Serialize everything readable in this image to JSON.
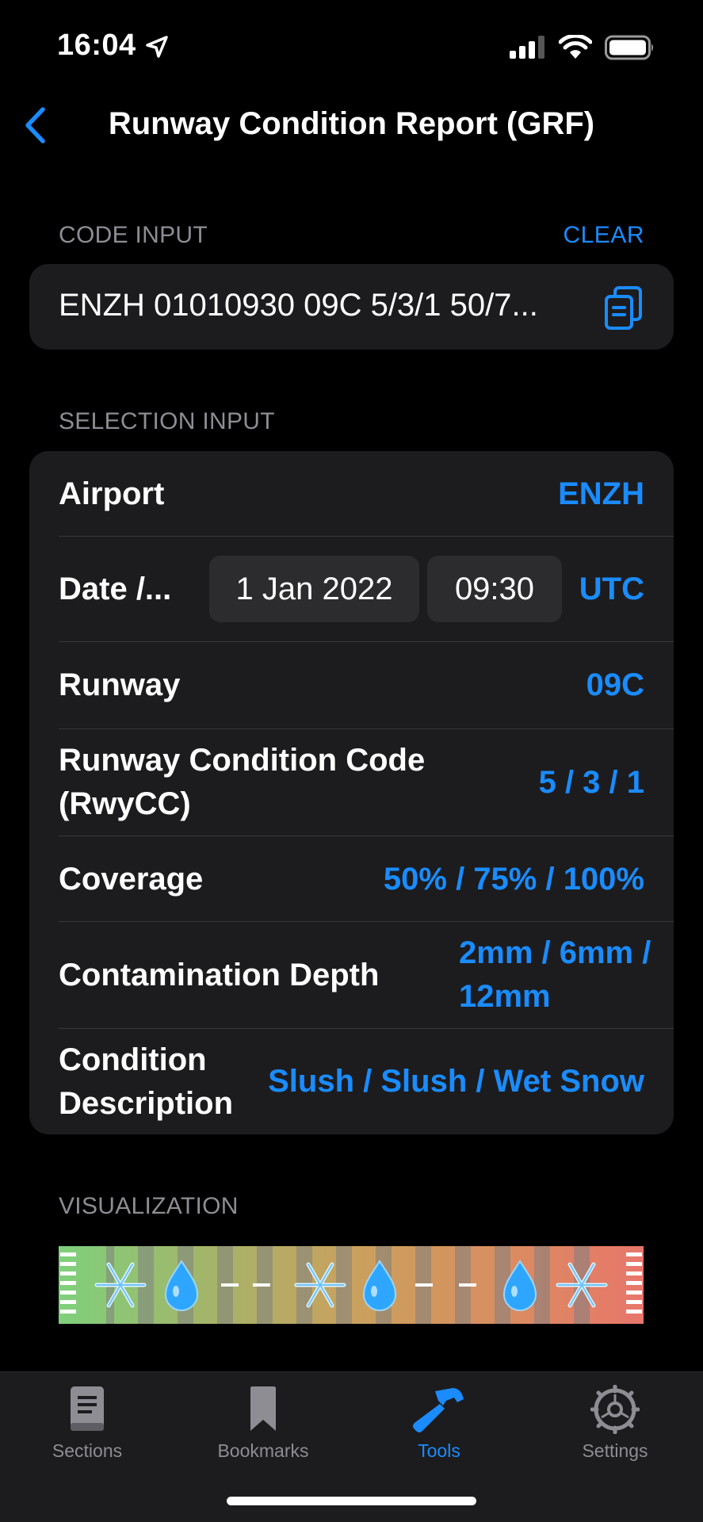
{
  "status": {
    "time": "16:04"
  },
  "nav": {
    "title": "Runway Condition Report (GRF)"
  },
  "code_input": {
    "header": "CODE INPUT",
    "clear_label": "CLEAR",
    "value": "ENZH 01010930 09C 5/3/1 50/7..."
  },
  "selection": {
    "header": "SELECTION INPUT",
    "rows": {
      "airport": {
        "label": "Airport",
        "value": "ENZH"
      },
      "datetime": {
        "label": "Date /...",
        "date": "1 Jan 2022",
        "time": "09:30",
        "zone": "UTC"
      },
      "runway": {
        "label": "Runway",
        "value": "09C"
      },
      "rwycc": {
        "label_line1": "Runway Condition Code",
        "label_line2": "(RwyCC)",
        "value": "5 / 3 / 1"
      },
      "coverage": {
        "label": "Coverage",
        "value": "50% / 75% / 100%"
      },
      "depth": {
        "label": "Contamination Depth",
        "value_line1": "2mm / 6mm /",
        "value_line2": "12mm"
      },
      "condition": {
        "label_line1": "Condition",
        "label_line2": "Description",
        "value": "Slush / Slush / Wet Snow"
      }
    }
  },
  "visualization": {
    "header": "VISUALIZATION",
    "thirds": [
      {
        "contaminants": [
          "snowflake-icon",
          "water-drop-icon"
        ]
      },
      {
        "contaminants": [
          "snowflake-icon",
          "water-drop-icon"
        ]
      },
      {
        "contaminants": [
          "water-drop-icon",
          "snowflake-icon"
        ]
      }
    ],
    "gradient_colors": [
      "#7fd07c",
      "#a0b86a",
      "#c8a25e",
      "#d98f5e",
      "#e57a6a"
    ]
  },
  "tabs": [
    {
      "label": "Sections",
      "icon": "book-icon",
      "active": false
    },
    {
      "label": "Bookmarks",
      "icon": "bookmark-icon",
      "active": false
    },
    {
      "label": "Tools",
      "icon": "hammer-icon",
      "active": true
    },
    {
      "label": "Settings",
      "icon": "gear-icon",
      "active": false
    }
  ],
  "colors": {
    "accent": "#1a8cff",
    "card": "#1c1c1e",
    "secondary_text": "#8d8d93"
  }
}
